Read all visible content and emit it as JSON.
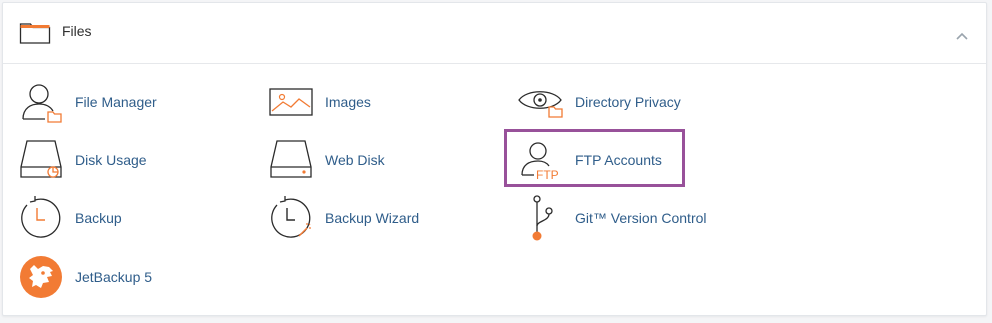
{
  "section": {
    "title": "Files",
    "icons": {
      "folder": "folder-icon",
      "collapse": "chevron-up-icon"
    }
  },
  "colors": {
    "accent_orange": "#f27b34",
    "link_blue": "#2f5d8a",
    "highlight_purple": "#98519a",
    "icon_stroke": "#2b2b2b"
  },
  "items": [
    {
      "label": "File Manager",
      "icon": "file-manager-icon"
    },
    {
      "label": "Images",
      "icon": "images-icon"
    },
    {
      "label": "Directory Privacy",
      "icon": "directory-privacy-icon"
    },
    {
      "label": "Disk Usage",
      "icon": "disk-usage-icon"
    },
    {
      "label": "Web Disk",
      "icon": "web-disk-icon"
    },
    {
      "label": "FTP Accounts",
      "icon": "ftp-accounts-icon",
      "highlighted": true
    },
    {
      "label": "Backup",
      "icon": "backup-icon"
    },
    {
      "label": "Backup Wizard",
      "icon": "backup-wizard-icon"
    },
    {
      "label": "Git™ Version Control",
      "icon": "git-version-control-icon"
    },
    {
      "label": "JetBackup 5",
      "icon": "jetbackup-icon"
    }
  ],
  "ftp_icon_text": "FTP"
}
